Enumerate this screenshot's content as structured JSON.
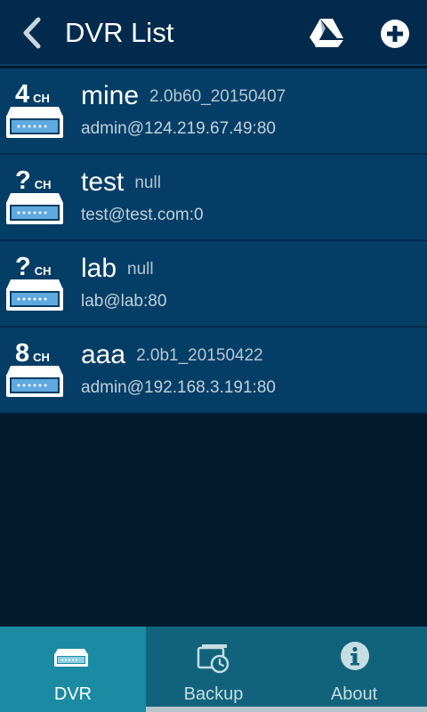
{
  "header": {
    "title": "DVR List"
  },
  "dvr_list": [
    {
      "channels": "4",
      "channel_unit": "CH",
      "name": "mine",
      "version": "2.0b60_20150407",
      "address": "admin@124.219.67.49:80"
    },
    {
      "channels": "?",
      "channel_unit": "CH",
      "name": "test",
      "version": "null",
      "address": "test@test.com:0"
    },
    {
      "channels": "?",
      "channel_unit": "CH",
      "name": "lab",
      "version": "null",
      "address": "lab@lab:80"
    },
    {
      "channels": "8",
      "channel_unit": "CH",
      "name": "aaa",
      "version": "2.0b1_20150422",
      "address": "admin@192.168.3.191:80"
    }
  ],
  "tabs": [
    {
      "label": "DVR",
      "icon": "dvr-icon",
      "active": true
    },
    {
      "label": "Backup",
      "icon": "backup-icon",
      "active": false
    },
    {
      "label": "About",
      "icon": "info-icon",
      "active": false
    }
  ],
  "colors": {
    "header_bg": "#022a4d",
    "row_bg": "#043e66",
    "page_bg": "#011a2e",
    "tabbar_bg": "#10637b",
    "tab_active_bg": "#1a8ba2"
  }
}
